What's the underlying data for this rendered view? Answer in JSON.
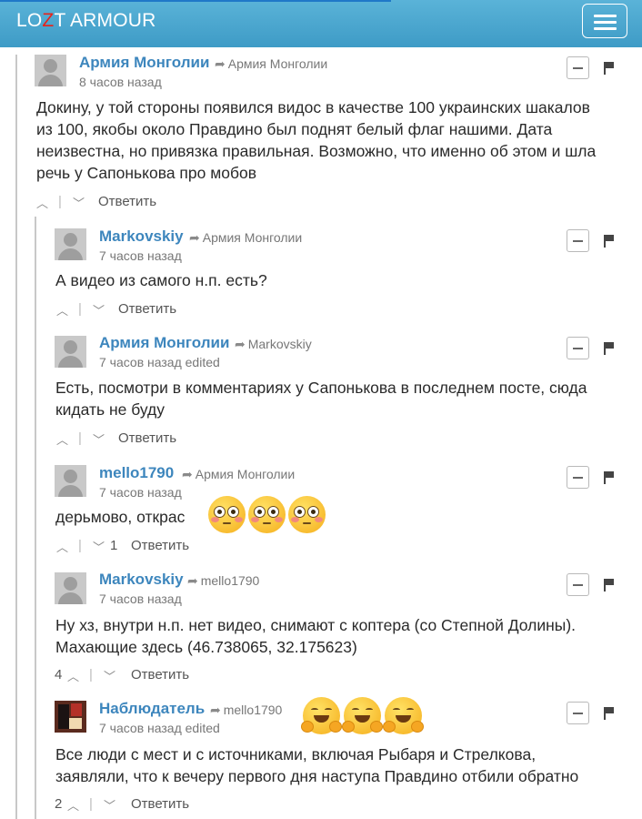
{
  "brand": {
    "prefix": "LO",
    "highlight": "Z",
    "suffix": "T ARMOUR"
  },
  "colors": {
    "navbar": "#4aa6d0",
    "author": "#3d86bd",
    "brand_accent": "#e8231a"
  },
  "icons": {
    "reply_arrow": "share-arrow-icon",
    "minimize": "minimize-icon",
    "flag": "flag-icon",
    "menu": "hamburger-menu-icon"
  },
  "comments": [
    {
      "author": "Армия Монголии",
      "reply_to": "Армия Монголии",
      "time": "8 часов назад",
      "lines": [
        "Докину, у той стороны появился видос в качестве 100 украинских шакалов",
        "из 100, якобы около Правдино был поднят белый флаг нашими. Дата",
        "неизвестна, но привязка правильная. Возможно, что именно об этом и шла",
        "речь у Сапонькова про мобов"
      ],
      "votes_up": "",
      "votes_down": "",
      "reply_label": "Ответить"
    },
    {
      "author": "Markovskiy",
      "reply_to": "Армия Монголии",
      "time": "7 часов назад",
      "lines": [
        "А видео из самого н.п. есть?"
      ],
      "votes_up": "",
      "votes_down": "",
      "reply_label": "Ответить"
    },
    {
      "author": "Армия Монголии",
      "reply_to": "Markovskiy",
      "time": "7 часов назад edited",
      "lines": [
        "Есть, посмотри в комментариях у Сапонькова в последнем посте, сюда",
        "кидать не буду"
      ],
      "votes_up": "",
      "votes_down": "",
      "reply_label": "Ответить"
    },
    {
      "author": "mello1790",
      "reply_to": "Армия Монголии",
      "time": "7 часов назад",
      "lines": [
        "дерьмово, открас"
      ],
      "emoji": "flushed-face-icon",
      "votes_up": "",
      "votes_down": "1",
      "reply_label": "Ответить"
    },
    {
      "author": "Markovskiy",
      "reply_to": "mello1790",
      "time": "7 часов назад",
      "lines": [
        "Ну хз, внутри н.п. нет видео, снимают с коптера (со Степной Долины).",
        "Махающие здесь (46.738065, 32.175623)"
      ],
      "votes_up": "4",
      "votes_down": "",
      "reply_label": "Ответить"
    },
    {
      "author": "Наблюдатель",
      "reply_to": "mello1790",
      "time": "7 часов назад edited",
      "emoji": "hugging-face-icon",
      "lines": [
        "Все люди с мест и с источниками, включая Рыбаря и Стрелкова,",
        "заявляли, что к вечеру первого дня наступа Правдино отбили обратно"
      ],
      "votes_up": "2",
      "votes_down": "",
      "reply_label": "Ответить"
    }
  ]
}
